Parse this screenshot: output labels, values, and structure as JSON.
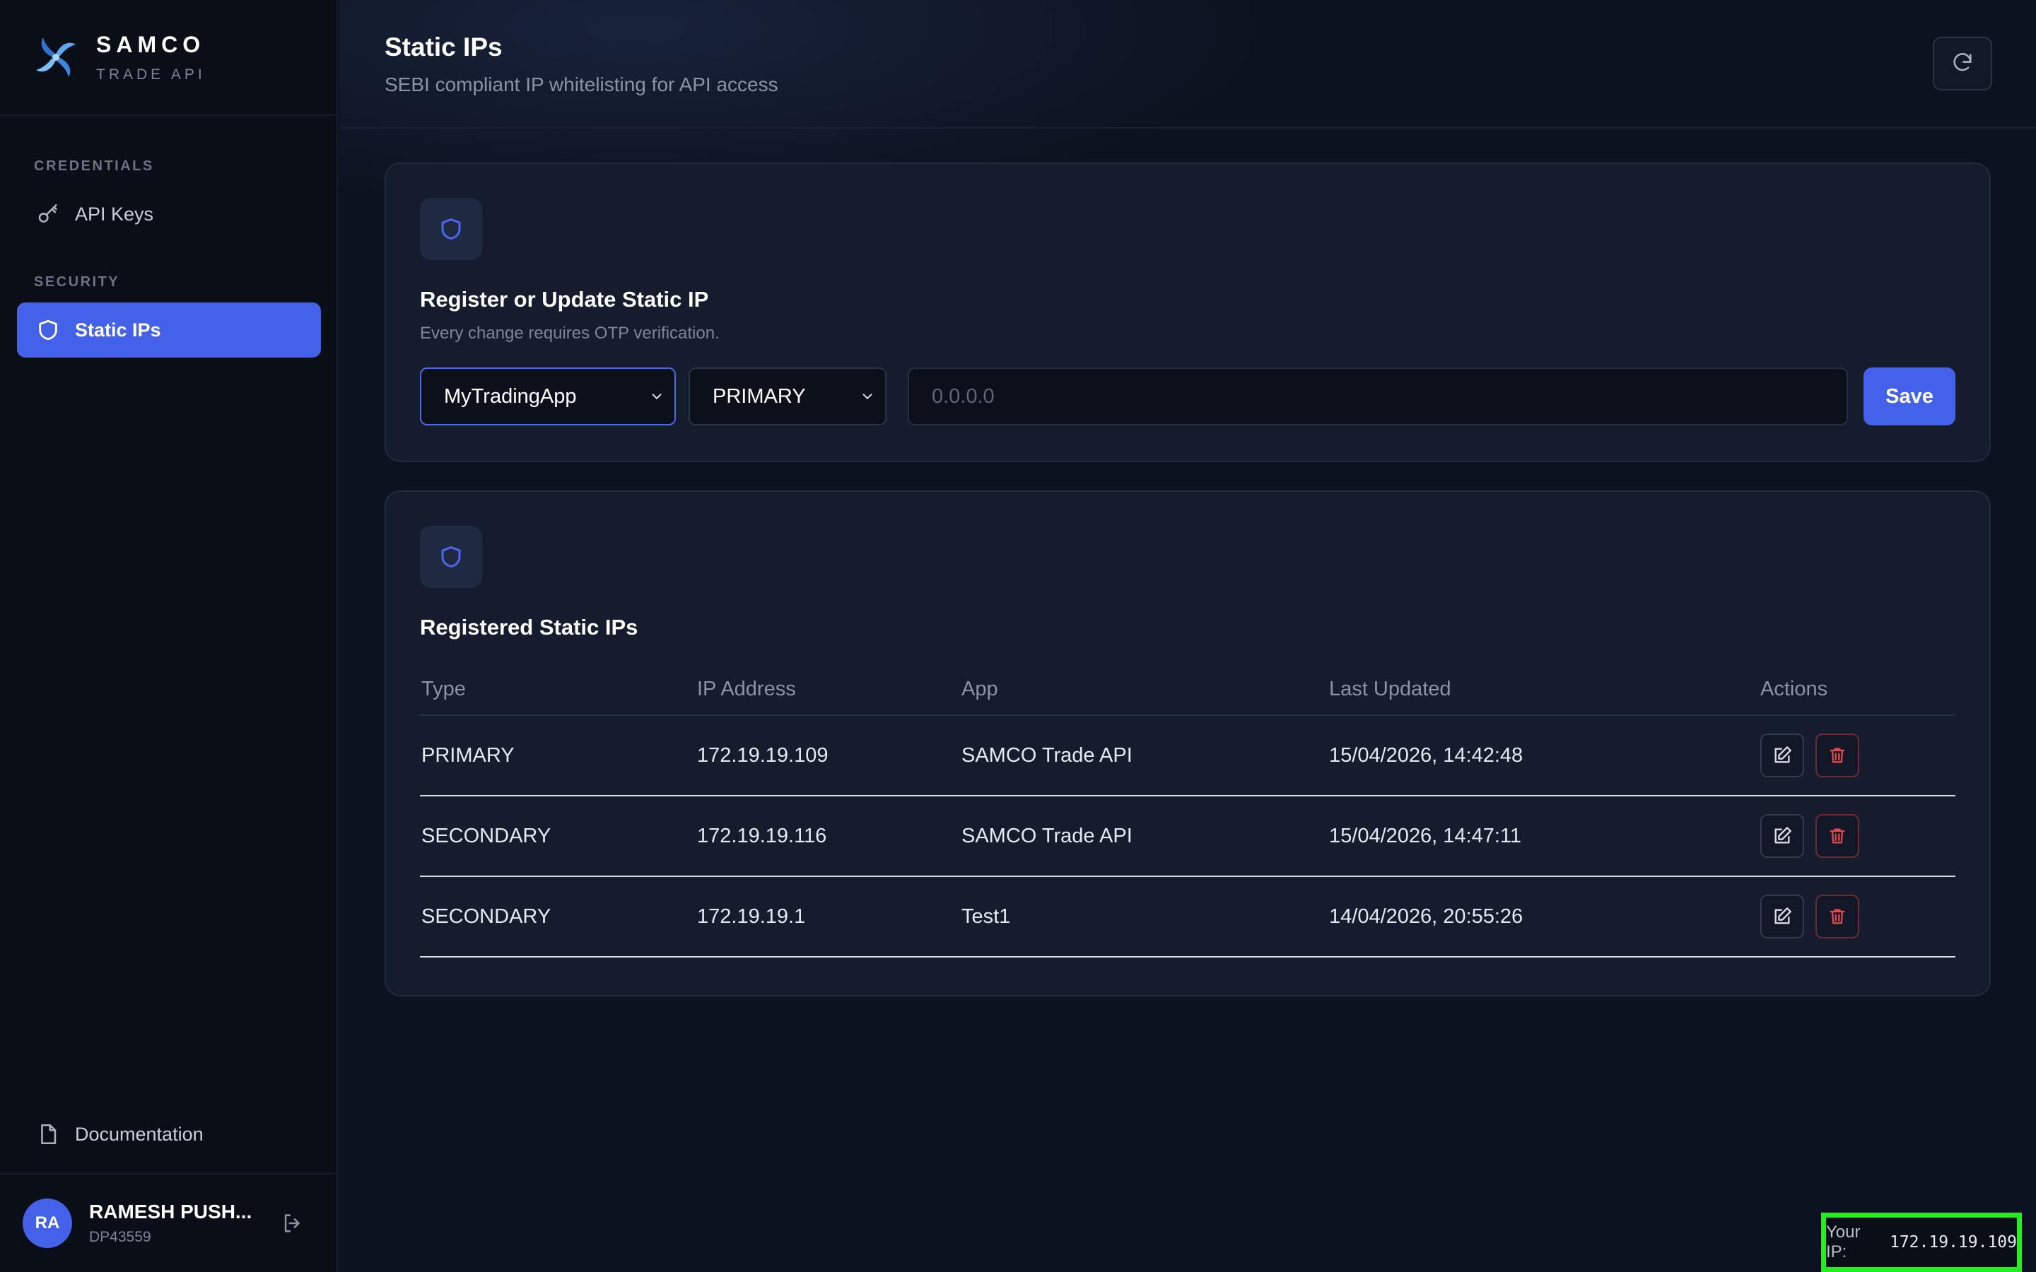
{
  "brand": {
    "name": "SAMCO",
    "subtitle": "TRADE API"
  },
  "sidebar": {
    "sections": [
      {
        "label": "CREDENTIALS",
        "items": [
          {
            "label": "API Keys",
            "icon": "key-icon"
          }
        ]
      },
      {
        "label": "SECURITY",
        "items": [
          {
            "label": "Static IPs",
            "icon": "shield-icon",
            "active": true
          }
        ]
      }
    ],
    "footer_link": {
      "label": "Documentation",
      "icon": "document-icon"
    }
  },
  "user": {
    "initials": "RA",
    "name": "RAMESH PUSH...",
    "id": "DP43559"
  },
  "header": {
    "title": "Static IPs",
    "subtitle": "SEBI compliant IP whitelisting for API access"
  },
  "register_card": {
    "title": "Register or Update Static IP",
    "description": "Every change requires OTP verification.",
    "app_select": {
      "value": "MyTradingApp"
    },
    "type_select": {
      "value": "PRIMARY"
    },
    "ip_input": {
      "value": "",
      "placeholder": "0.0.0.0"
    },
    "save_label": "Save"
  },
  "registered_card": {
    "title": "Registered Static IPs",
    "columns": [
      "Type",
      "IP Address",
      "App",
      "Last Updated",
      "Actions"
    ],
    "rows": [
      {
        "type": "PRIMARY",
        "ip": "172.19.19.109",
        "app": "SAMCO Trade API",
        "updated": "15/04/2026, 14:42:48"
      },
      {
        "type": "SECONDARY",
        "ip": "172.19.19.116",
        "app": "SAMCO Trade API",
        "updated": "15/04/2026, 14:47:11"
      },
      {
        "type": "SECONDARY",
        "ip": "172.19.19.1",
        "app": "Test1",
        "updated": "14/04/2026, 20:55:26"
      }
    ]
  },
  "footer": {
    "your_ip_label": "Your IP:",
    "your_ip_value": "172.19.19.109"
  },
  "colors": {
    "accent": "#4461ea",
    "danger": "#e5484d",
    "highlight": "#22ee22"
  }
}
